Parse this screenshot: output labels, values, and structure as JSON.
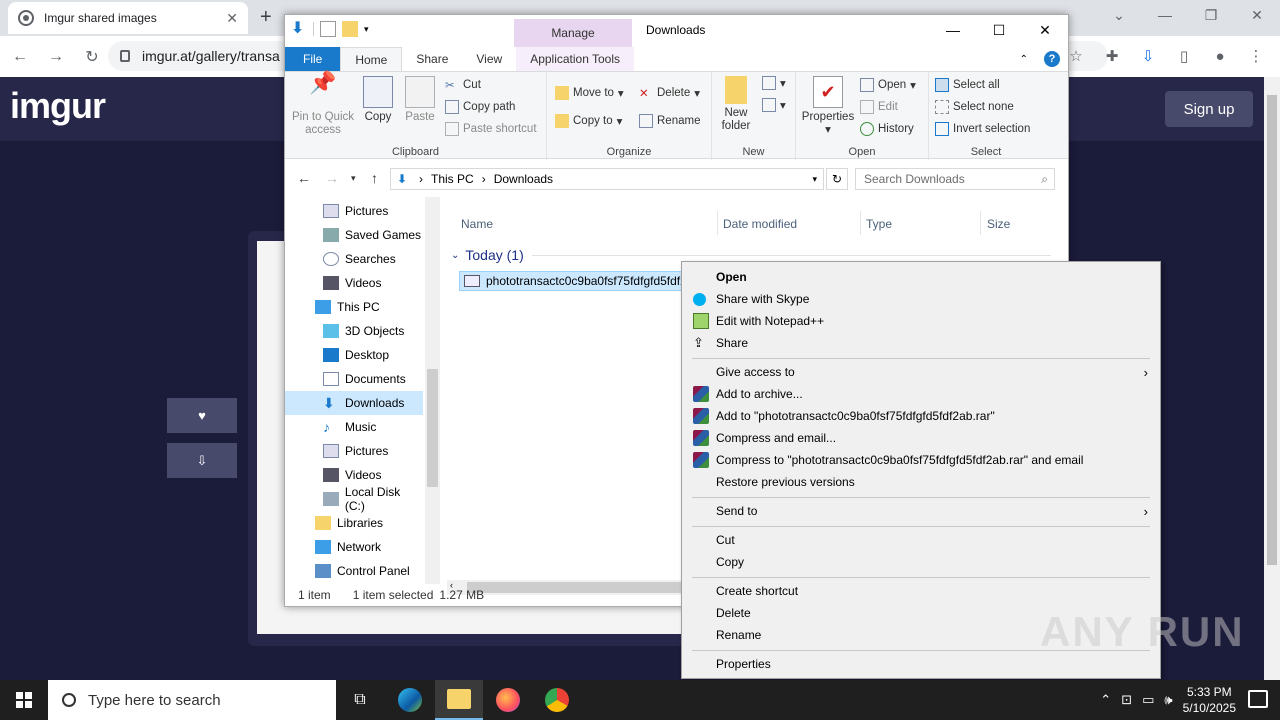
{
  "browser": {
    "tab_title": "Imgur shared images",
    "tab_close": "✕",
    "new_tab": "+",
    "url": "imgur.at/gallery/transa"
  },
  "imgur": {
    "logo": "imgur",
    "signup": "Sign up",
    "like_icon": "♥",
    "download_icon": "⇩"
  },
  "explorer": {
    "title": "Downloads",
    "manage_tab": "Manage",
    "tabs": [
      "File",
      "Home",
      "Share",
      "View",
      "Application Tools"
    ],
    "clipboard": {
      "label": "Clipboard",
      "pin": "Pin to Quick access",
      "copy": "Copy",
      "paste": "Paste",
      "cut": "Cut",
      "copy_path": "Copy path",
      "paste_shortcut": "Paste shortcut"
    },
    "organize": {
      "label": "Organize",
      "move_to": "Move to",
      "copy_to": "Copy to",
      "delete": "Delete",
      "rename": "Rename"
    },
    "new": {
      "label": "New",
      "new_folder": "New folder"
    },
    "open": {
      "label": "Open",
      "properties": "Properties",
      "open": "Open",
      "edit": "Edit",
      "history": "History"
    },
    "select": {
      "label": "Select",
      "select_all": "Select all",
      "select_none": "Select none",
      "invert": "Invert selection"
    },
    "address": {
      "this_pc": "This PC",
      "downloads": "Downloads",
      "search_placeholder": "Search Downloads"
    },
    "nav_items": [
      "Pictures",
      "Saved Games",
      "Searches",
      "Videos",
      "This PC",
      "3D Objects",
      "Desktop",
      "Documents",
      "Downloads",
      "Music",
      "Pictures",
      "Videos",
      "Local Disk (C:)",
      "Libraries",
      "Network",
      "Control Panel"
    ],
    "columns": {
      "name": "Name",
      "date": "Date modified",
      "type": "Type",
      "size": "Size"
    },
    "group": "Today (1)",
    "file_name": "phototransactc0c9ba0fsf75fdfgfd5fdf2",
    "status": {
      "items": "1 item",
      "selected": "1 item selected",
      "size": "1.27 MB"
    }
  },
  "context_menu": {
    "open": "Open",
    "skype": "Share with Skype",
    "notepad": "Edit with Notepad++",
    "share": "Share",
    "give_access": "Give access to",
    "add_archive": "Add to archive...",
    "add_rar": "Add to \"phototransactc0c9ba0fsf75fdfgfd5fdf2ab.rar\"",
    "compress_email": "Compress and email...",
    "compress_rar_email": "Compress to \"phototransactc0c9ba0fsf75fdfgfd5fdf2ab.rar\" and email",
    "restore": "Restore previous versions",
    "send_to": "Send to",
    "cut": "Cut",
    "copy": "Copy",
    "create_shortcut": "Create shortcut",
    "delete": "Delete",
    "rename": "Rename",
    "properties": "Properties"
  },
  "taskbar": {
    "search_placeholder": "Type here to search",
    "time": "5:33 PM",
    "date": "5/10/2025"
  },
  "watermark": "ANY RUN"
}
